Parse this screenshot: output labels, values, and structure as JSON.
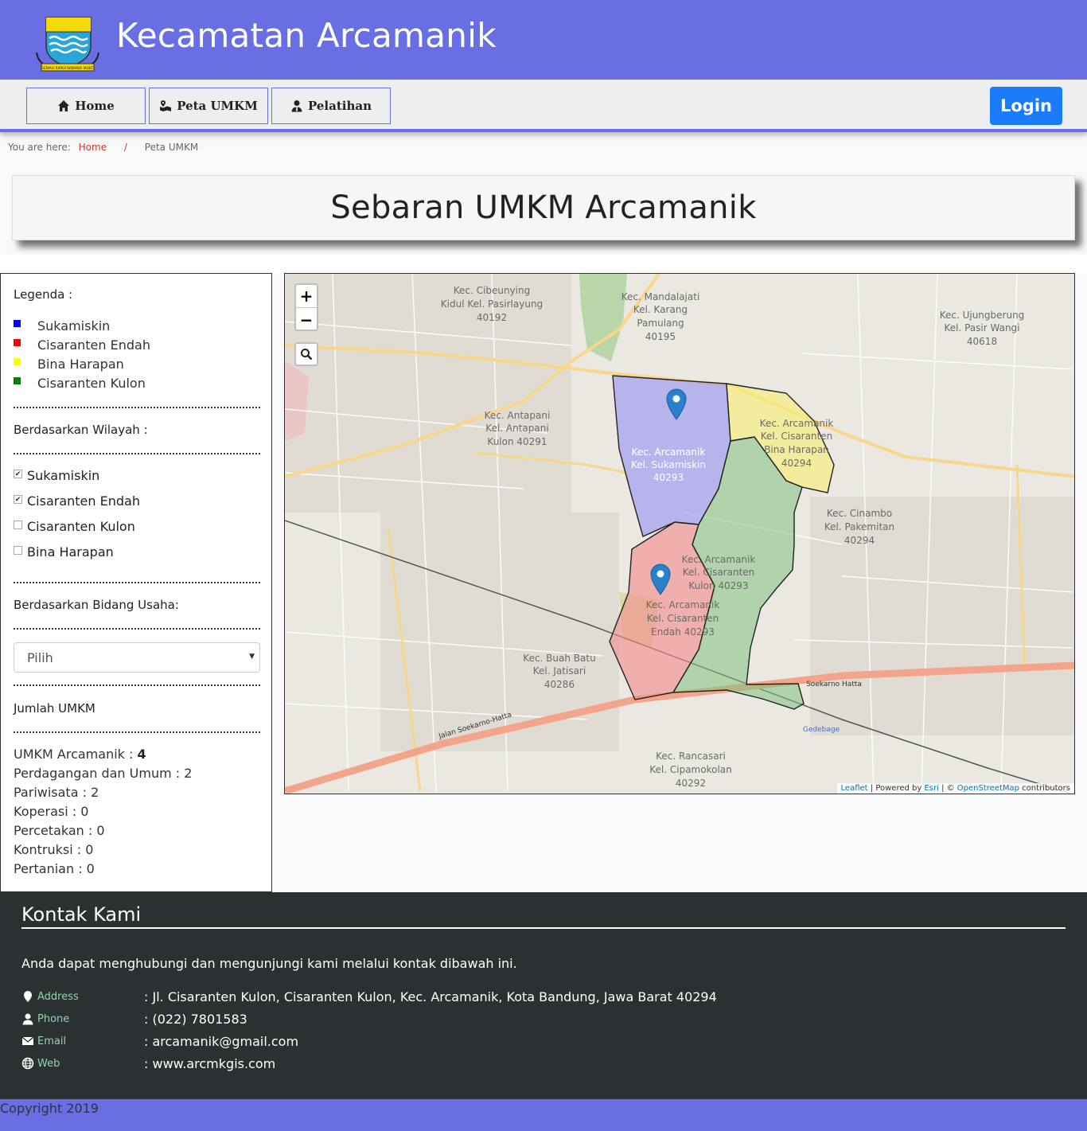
{
  "header": {
    "title": "Kecamatan Arcamanik",
    "logo_text": "GEMAH RIPAH WIBAWA MUKTI"
  },
  "nav": {
    "home": "Home",
    "peta": "Peta UMKM",
    "pelatihan": "Pelatihan",
    "login": "Login"
  },
  "breadcrumb": {
    "prefix": "You are here:",
    "home": "Home",
    "separator": "/",
    "current": "Peta UMKM"
  },
  "page_title": "Sebaran UMKM Arcamanik",
  "sidebar": {
    "legend_title": "Legenda :",
    "legend": [
      {
        "label": "Sukamiskin",
        "color": "#0000ff"
      },
      {
        "label": "Cisaranten Endah",
        "color": "#ff0000"
      },
      {
        "label": "Bina Harapan",
        "color": "#ffff00"
      },
      {
        "label": "Cisaranten Kulon",
        "color": "#008000"
      }
    ],
    "wilayah_title": "Berdasarkan Wilayah :",
    "wilayah": [
      {
        "label": "Sukamiskin",
        "checked": true
      },
      {
        "label": "Cisaranten Endah",
        "checked": true
      },
      {
        "label": "Cisaranten Kulon",
        "checked": false
      },
      {
        "label": "Bina Harapan",
        "checked": false
      }
    ],
    "bidang_title": "Berdasarkan Bidang Usaha:",
    "bidang_select": "Pilih",
    "jumlah_title": "Jumlah UMKM",
    "stats": {
      "total_label": "UMKM Arcamanik : ",
      "total_value": "4",
      "rows": [
        "Perdagangan dan Umum : 2",
        "Pariwisata : 2",
        "Koperasi : 0",
        "Percetakan : 0",
        "Kontruksi : 0",
        "Pertanian : 0"
      ]
    }
  },
  "map": {
    "zoom_in": "+",
    "zoom_out": "−",
    "attribution": {
      "leaflet": "Leaflet",
      "powered": " | Powered by ",
      "esri": "Esri",
      "sep": " | © ",
      "osm": "OpenStreetMap",
      "contrib": " contributors"
    },
    "labels": [
      "Kec. Arcamanik",
      "Kel. Sukamiskin",
      "40293",
      "Kec. Arcamanik",
      "Kel. Cisaranten",
      "Bina Harapan",
      "40294",
      "Kec. Arcamanik",
      "Kel. Cisaranten",
      "Kulon 40293",
      "Kec. Arcamanik",
      "Kel. Cisaranten",
      "Endah 40293",
      "Kec. Mandalajati",
      "Kel. Karang",
      "Pamulang",
      "40195",
      "Kec. Cibeunying",
      "Kidul Kel. Pasirlayung",
      "40192",
      "Kec. Antapani",
      "Kel. Antapani",
      "Kulon 40291",
      "Kec. Cinambo",
      "Kel. Pakemitan",
      "40294",
      "Kec. Buah Batu",
      "Kel. Jatisari",
      "40286",
      "Kec. Rancasari",
      "Kel. Cipamokolan",
      "40292",
      "Soekarno Hatta",
      "Jalan Soekarno-Hatta",
      "Gedebage",
      "Kec. Ujungberung",
      "Kel. Pasir Wangi",
      "40618"
    ]
  },
  "colors": {
    "accent": "#6a6ee3",
    "login": "#1a7cf8",
    "footer": "#2b3133"
  },
  "footer": {
    "title": "Kontak Kami",
    "intro": "Anda dapat menghubungi dan mengunjungi kami melalui kontak dibawah ini.",
    "contacts": [
      {
        "label": "Address",
        "value": ": Jl. Cisaranten Kulon, Cisaranten Kulon, Kec. Arcamanik, Kota Bandung, Jawa Barat 40294",
        "icon": "map-marker-icon"
      },
      {
        "label": "Phone",
        "value": ": (022) 7801583",
        "icon": "user-icon"
      },
      {
        "label": "Email",
        "value": ": arcamanik@gmail.com",
        "icon": "envelope-icon"
      },
      {
        "label": "Web",
        "value": ": www.arcmkgis.com",
        "icon": "globe-icon"
      }
    ],
    "copyright": "Copyright 2019"
  }
}
